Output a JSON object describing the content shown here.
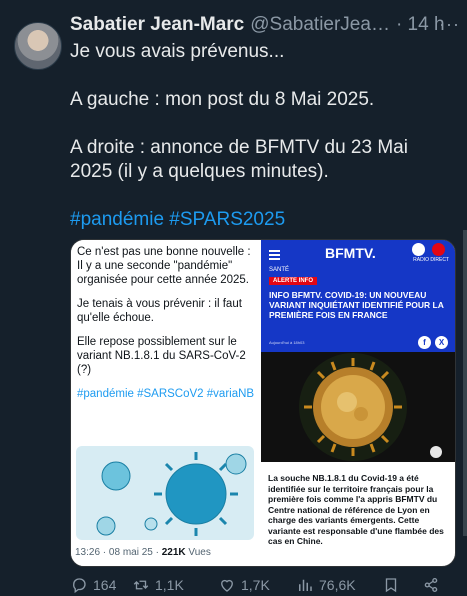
{
  "author": {
    "name": "Sabatier Jean-Marc",
    "handle": "@SabatierJea…",
    "time": "· 14 h",
    "more": "···"
  },
  "post": {
    "line1": "Je vous avais prévenus...",
    "line2": "A gauche : mon post du 8 Mai 2025.",
    "line3": "A droite : annonce de BFMTV du 23 Mai 2025 (il y a quelques minutes).",
    "hashtags": "#pandémie #SPARS2025"
  },
  "embedded_left": {
    "p1": "Ce n'est pas une bonne nouvelle : Il y a une seconde \"pandémie\" organisée pour cette année 2025.",
    "p2": "Je tenais à vous prévenir : il faut qu'elle échoue.",
    "p3": "Elle repose possiblement sur le variant NB.1.8.1 du SARS-CoV-2 (?)",
    "tags": "#pandémie #SARSCoV2 #variaNB",
    "meta_time": "13:26 · 08 mai 25 · ",
    "meta_views_num": "221K",
    "meta_views_label": " Vues"
  },
  "embedded_right": {
    "logo": "BFMTV.",
    "radio": "RADIO",
    "direct": "DIRECT",
    "section": "SANTÉ",
    "alert": "ALERTE INFO",
    "headline": "INFO BFMTV. COVID-19: UN NOUVEAU VARIANT INQUIÉTANT IDENTIFIÉ POUR LA PREMIÈRE FOIS EN FRANCE",
    "byline": "Aujourd'hui à 18h03",
    "fb": "f",
    "x": "X",
    "caption": "La souche NB.1.8.1 du Covid-19 a été identifiée sur le territoire français pour la première fois comme l'a appris BFMTV du Centre national de référence de Lyon en charge des variants émergents. Cette variante est responsable d'une flambée des cas en Chine."
  },
  "actions": {
    "replies": "164",
    "reposts": "1,1K",
    "likes": "1,7K",
    "views": "76,6K"
  },
  "colors": {
    "background": "#15202b",
    "link": "#1d9bf0",
    "bfm_blue": "#1537c6",
    "alert_red": "#e30613"
  },
  "icons": [
    "reply-icon",
    "repost-icon",
    "like-icon",
    "views-icon",
    "bookmark-icon",
    "share-icon"
  ]
}
